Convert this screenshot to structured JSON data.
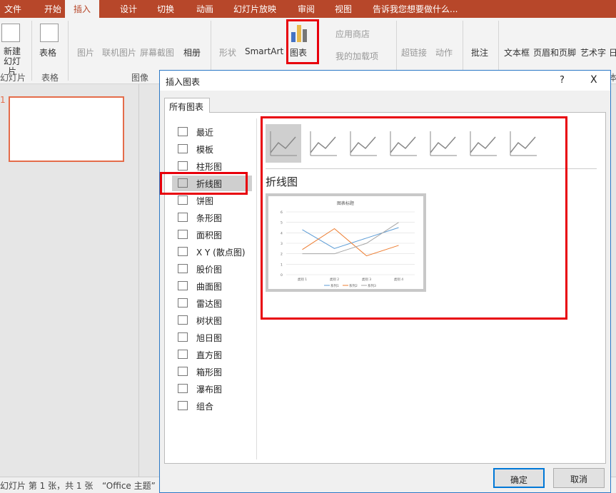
{
  "ribbon_tabs": [
    "文件",
    "开始",
    "插入",
    "设计",
    "切换",
    "动画",
    "幻灯片放映",
    "审阅",
    "视图"
  ],
  "active_tab": "插入",
  "tell_me": "告诉我您想要做什么...",
  "ribbon": {
    "new_slide": [
      "新建",
      "幻灯片"
    ],
    "table": "表格",
    "picture": "图片",
    "online_picture": "联机图片",
    "screenshot": "屏幕截图",
    "album": "相册",
    "shapes": "形状",
    "smartart": "SmartArt",
    "chart": "图表",
    "store": "应用商店",
    "my_addins": "我的加载项",
    "hyperlink": "超链接",
    "action": "动作",
    "comment": "批注",
    "textbox": "文本框",
    "header_footer": "页眉和页脚",
    "wordart": "艺术字",
    "date": "日",
    "groups": {
      "slides": "幻灯片",
      "tables": "表格",
      "images": "图像",
      "text": "本"
    }
  },
  "slide_number": "1",
  "status": {
    "slide": "幻灯片 第 1 张，共 1 张",
    "theme": "“Office 主题”"
  },
  "dialog": {
    "title": "插入图表",
    "help": "?",
    "close": "X",
    "tab": "所有图表",
    "categories": [
      "最近",
      "模板",
      "柱形图",
      "折线图",
      "饼图",
      "条形图",
      "面积图",
      "X Y (散点图)",
      "股价图",
      "曲面图",
      "雷达图",
      "树状图",
      "旭日图",
      "直方图",
      "箱形图",
      "瀑布图",
      "组合"
    ],
    "selected_category": "折线图",
    "subtype_heading": "折线图",
    "ok": "确定",
    "cancel": "取消"
  },
  "colors": {
    "accent": "#b7472a",
    "highlight": "#e8000b",
    "series": [
      "#5b9bd5",
      "#ed7d31",
      "#a5a5a5"
    ]
  },
  "chart_data": {
    "type": "line",
    "title": "图表标题",
    "categories": [
      "类别 1",
      "类别 2",
      "类别 3",
      "类别 4"
    ],
    "ylim": [
      0,
      6
    ],
    "yticks": [
      0,
      1,
      2,
      3,
      4,
      5,
      6
    ],
    "grid": true,
    "legend": "bottom",
    "series": [
      {
        "name": "系列1",
        "values": [
          4.3,
          2.5,
          3.5,
          4.5
        ]
      },
      {
        "name": "系列2",
        "values": [
          2.4,
          4.4,
          1.8,
          2.8
        ]
      },
      {
        "name": "系列3",
        "values": [
          2,
          2,
          3,
          5
        ]
      }
    ]
  }
}
